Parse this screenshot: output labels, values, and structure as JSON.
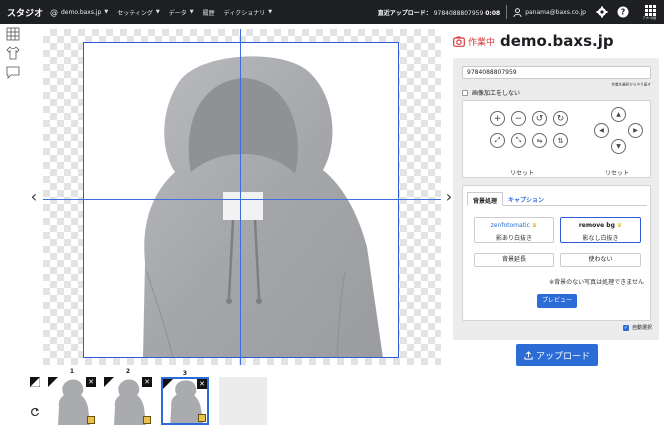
{
  "topbar": {
    "brand": "スタジオ",
    "nav": [
      {
        "label": "demo.baxs.jp"
      },
      {
        "label": "セッティング"
      },
      {
        "label": "データ"
      },
      {
        "label": "履歴"
      },
      {
        "label": "ディクショナリ"
      }
    ],
    "recent_label": "直近アップロード：",
    "recent_code": "9784088807959",
    "recent_time": "0:08",
    "user": "panama@baxs.co.jp",
    "apps_label": "アプリ切替"
  },
  "thumbnails": [
    {
      "num": "1"
    },
    {
      "num": "2"
    },
    {
      "num": "3"
    }
  ],
  "panel": {
    "status": "作業中",
    "site": "demo.baxs.jp",
    "code_value": "9784088807959",
    "hint": "作業を最初からやり直す",
    "no_edit_label": "画像加工をしない",
    "reset_left": "リセット",
    "reset_right": "リセット",
    "tabs": [
      "背景処理",
      "キャプション"
    ],
    "zen_brand": "zenfotomatic",
    "zen_desc": "影あり白抜き",
    "removebg_brand": "remove bg",
    "removebg_desc": "影なし白抜き",
    "extend": "背景延長",
    "none": "使わない",
    "note": "※背景のない写真は処理できません",
    "preview": "プレビュー",
    "auto": "自動選択"
  },
  "upload_label": "アップロード",
  "colors": {
    "accent": "#2b6cd6",
    "status": "#d53a3a",
    "topbar": "#1d1f23"
  }
}
